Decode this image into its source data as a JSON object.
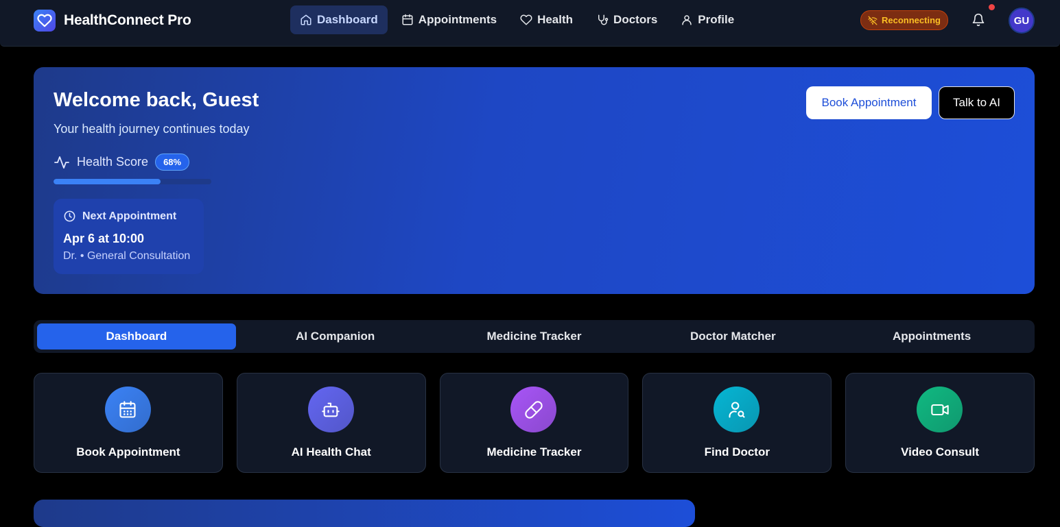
{
  "app": {
    "name": "HealthConnect Pro"
  },
  "nav": {
    "items": [
      {
        "label": "Dashboard",
        "icon": "home-icon",
        "active": true
      },
      {
        "label": "Appointments",
        "icon": "calendar-icon",
        "active": false
      },
      {
        "label": "Health",
        "icon": "heart-icon",
        "active": false
      },
      {
        "label": "Doctors",
        "icon": "stethoscope-icon",
        "active": false
      },
      {
        "label": "Profile",
        "icon": "user-icon",
        "active": false
      }
    ]
  },
  "header": {
    "status": "Reconnecting",
    "avatar_initials": "GU"
  },
  "hero": {
    "title": "Welcome back, Guest",
    "subtitle": "Your health journey continues today",
    "health_score_label": "Health Score",
    "health_score_value": "68%",
    "health_score_fraction": 0.68,
    "book_button": "Book Appointment",
    "ai_button": "Talk to AI",
    "next_appointment": {
      "heading": "Next Appointment",
      "date": "Apr 6 at 10:00",
      "detail": "Dr. • General Consultation"
    }
  },
  "tabs": [
    {
      "label": "Dashboard",
      "active": true
    },
    {
      "label": "AI Companion",
      "active": false
    },
    {
      "label": "Medicine Tracker",
      "active": false
    },
    {
      "label": "Doctor Matcher",
      "active": false
    },
    {
      "label": "Appointments",
      "active": false
    }
  ],
  "quick_actions": [
    {
      "label": "Book Appointment",
      "icon": "calendar-icon",
      "color": "#3b82f6"
    },
    {
      "label": "AI Health Chat",
      "icon": "bot-icon",
      "color": "#6366f1"
    },
    {
      "label": "Medicine Tracker",
      "icon": "pill-icon",
      "color": "#a855f7"
    },
    {
      "label": "Find Doctor",
      "icon": "user-search-icon",
      "color": "#06b6d4"
    },
    {
      "label": "Video Consult",
      "icon": "video-icon",
      "color": "#10b981"
    }
  ],
  "colors": {
    "background": "#000000",
    "topbar": "#111827",
    "accent": "#2563eb",
    "status_warning": "#f59e0b"
  }
}
